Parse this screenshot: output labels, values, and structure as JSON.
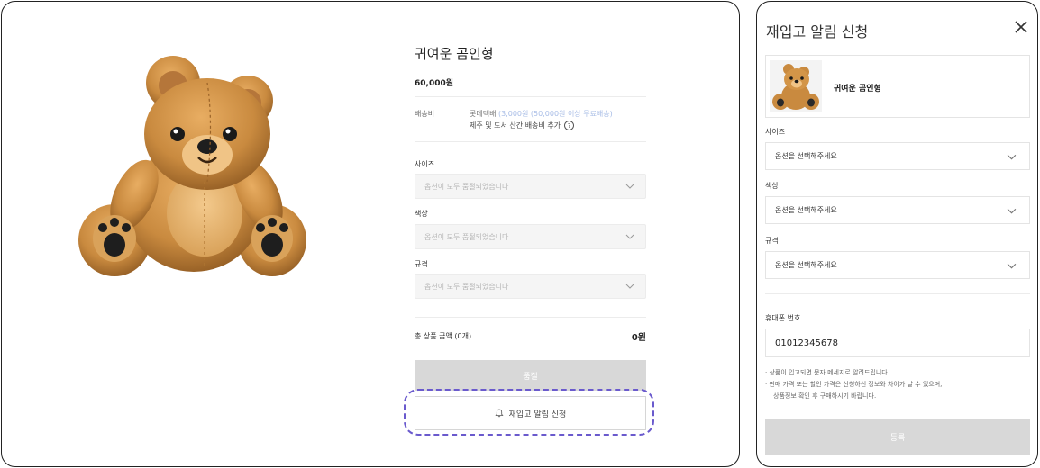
{
  "product": {
    "title": "귀여운 곰인형",
    "price": "60,000원",
    "shipping": {
      "label": "배송비",
      "carrier": "롯데택배",
      "condition": "(3,000원 (50,000원 이상 무료배송)",
      "extra": "제주 및 도서 산간 배송비 추가",
      "help_icon": "question-circle-icon"
    },
    "options": [
      {
        "label": "사이즈",
        "placeholder": "옵션이 모두 품절되었습니다"
      },
      {
        "label": "색상",
        "placeholder": "옵션이 모두 품절되었습니다"
      },
      {
        "label": "규격",
        "placeholder": "옵션이 모두 품절되었습니다"
      }
    ],
    "total_label": "총 상품 금액 (0개)",
    "total_value": "0원",
    "buy_button": "품절",
    "restock_button": "재입고 알림 신청",
    "restock_icon": "bell-icon",
    "highlight_color": "#6a5acd"
  },
  "restock_modal": {
    "title": "재입고 알림 신청",
    "close_icon": "close-icon",
    "product_name": "귀여운 곰인형",
    "options": [
      {
        "label": "사이즈",
        "value": "옵션을 선택해주세요"
      },
      {
        "label": "색상",
        "value": "옵션을 선택해주세요"
      },
      {
        "label": "규격",
        "value": "옵션을 선택해주세요"
      }
    ],
    "phone_label": "휴대폰 번호",
    "phone_value": "01012345678",
    "notes": [
      "· 상품이 입고되면 문자 메세지로 알려드립니다.",
      "· 판매 가격 또는 할인 가격은 신청하신 정보와 차이가 날 수 있으며,",
      "상품정보 확인 후 구매하시기 바랍니다."
    ],
    "submit_button": "등록"
  }
}
